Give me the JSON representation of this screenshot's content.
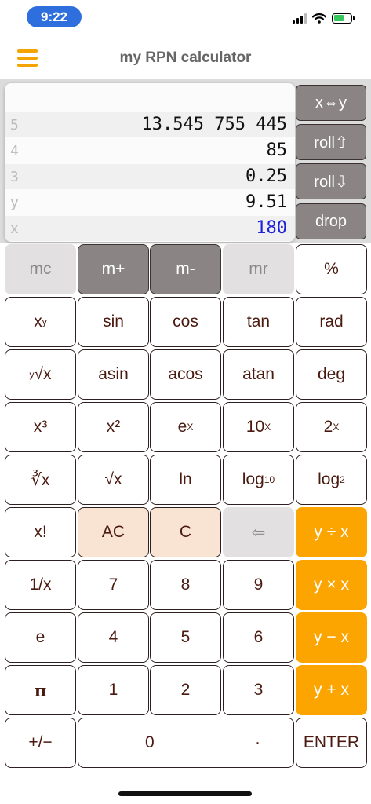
{
  "status": {
    "time": "9:22"
  },
  "nav": {
    "title": "my RPN calculator",
    "menu_icon": "hamburger-menu-icon"
  },
  "stack": [
    {
      "reg": "",
      "value": ""
    },
    {
      "reg": "5",
      "value": "13.545 755 445"
    },
    {
      "reg": "4",
      "value": "85"
    },
    {
      "reg": "3",
      "value": "0.25"
    },
    {
      "reg": "y",
      "value": "9.51"
    },
    {
      "reg": "x",
      "value": "180"
    }
  ],
  "stack_buttons": {
    "swap": "x⇔y",
    "roll_up": "roll⇧",
    "roll_down": "roll⇩",
    "drop": "drop"
  },
  "keys": {
    "mc": "mc",
    "mplus": "m+",
    "mminus": "m-",
    "mr": "mr",
    "percent": "%",
    "xy_base": "x",
    "xy_exp": "y",
    "sin": "sin",
    "cos": "cos",
    "tan": "tan",
    "rad": "rad",
    "yroot_idx": "y",
    "yroot_main": "√x",
    "asin": "asin",
    "acos": "acos",
    "atan": "atan",
    "deg": "deg",
    "cube": "x³",
    "square": "x²",
    "ex_base": "e",
    "ex_exp": "X",
    "tenx_base": "10",
    "tenx_exp": "X",
    "twox_base": "2",
    "twox_exp": "X",
    "cuberoot": "∛x",
    "sqrt": "√x",
    "ln": "ln",
    "log10_base": "log",
    "log10_sub": "10",
    "log2_base": "log",
    "log2_sub": "2",
    "fact": "x!",
    "ac": "AC",
    "c": "C",
    "backspace": "⇦",
    "div": "y ÷ x",
    "recip": "1/x",
    "d7": "7",
    "d8": "8",
    "d9": "9",
    "mul": "y × x",
    "e": "e",
    "d4": "4",
    "d5": "5",
    "d6": "6",
    "sub": "y − x",
    "pi": "π",
    "d1": "1",
    "d2": "2",
    "d3": "3",
    "add": "y + x",
    "neg": "+/−",
    "d0": "0",
    "dot": "·",
    "enter": "ENTER"
  },
  "colors": {
    "accent": "#fca500",
    "x_value": "#1d22d6",
    "peach": "#f9e3d2",
    "memory_dark": "#8b8484"
  }
}
